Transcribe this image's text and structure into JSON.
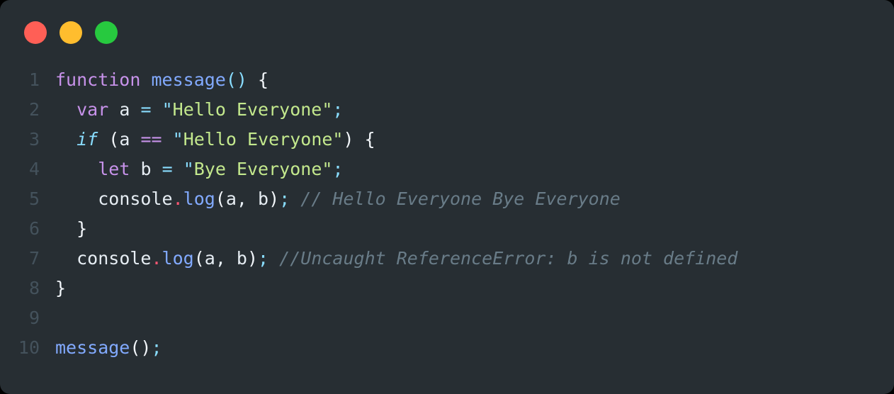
{
  "window": {
    "background_color": "#272e33",
    "outer_color": "#000000",
    "corner_radius_px": 14
  },
  "titlebar": {
    "buttons": [
      {
        "name": "close",
        "label": "",
        "color": "#ff5f56"
      },
      {
        "name": "minimize",
        "label": "",
        "color": "#ffbd2e"
      },
      {
        "name": "maximize",
        "label": "",
        "color": "#27c93f"
      }
    ]
  },
  "editor": {
    "language": "javascript",
    "line_numbers": [
      "1",
      "2",
      "3",
      "4",
      "5",
      "6",
      "7",
      "8",
      "9",
      "10"
    ],
    "lines": [
      {
        "number": "1",
        "text": "function message() {",
        "tokens": [
          {
            "t": "function",
            "c": "tok-keyword"
          },
          {
            "t": " ",
            "c": "tok-plain"
          },
          {
            "t": "message",
            "c": "tok-function"
          },
          {
            "t": "()",
            "c": "tok-punct"
          },
          {
            "t": " ",
            "c": "tok-plain"
          },
          {
            "t": "{",
            "c": "tok-brace"
          }
        ]
      },
      {
        "number": "2",
        "text": "  var a = \"Hello Everyone\";",
        "tokens": [
          {
            "t": "  ",
            "c": "tok-plain"
          },
          {
            "t": "var",
            "c": "tok-keyword"
          },
          {
            "t": " ",
            "c": "tok-plain"
          },
          {
            "t": "a",
            "c": "tok-plain"
          },
          {
            "t": " ",
            "c": "tok-plain"
          },
          {
            "t": "=",
            "c": "tok-assign"
          },
          {
            "t": " ",
            "c": "tok-plain"
          },
          {
            "t": "\"",
            "c": "tok-quote"
          },
          {
            "t": "Hello Everyone",
            "c": "tok-string"
          },
          {
            "t": "\"",
            "c": "tok-string"
          },
          {
            "t": ";",
            "c": "tok-punct"
          }
        ]
      },
      {
        "number": "3",
        "text": "  if (a == \"Hello Everyone\") {",
        "tokens": [
          {
            "t": "  ",
            "c": "tok-plain"
          },
          {
            "t": "if",
            "c": "tok-control"
          },
          {
            "t": " ",
            "c": "tok-plain"
          },
          {
            "t": "(",
            "c": "tok-brace"
          },
          {
            "t": "a",
            "c": "tok-plain"
          },
          {
            "t": " ",
            "c": "tok-plain"
          },
          {
            "t": "==",
            "c": "tok-operator"
          },
          {
            "t": " ",
            "c": "tok-plain"
          },
          {
            "t": "\"",
            "c": "tok-quote"
          },
          {
            "t": "Hello Everyone",
            "c": "tok-string"
          },
          {
            "t": "\"",
            "c": "tok-string"
          },
          {
            "t": ")",
            "c": "tok-brace"
          },
          {
            "t": " ",
            "c": "tok-plain"
          },
          {
            "t": "{",
            "c": "tok-brace"
          }
        ]
      },
      {
        "number": "4",
        "text": "    let b = \"Bye Everyone\";",
        "tokens": [
          {
            "t": "    ",
            "c": "tok-plain"
          },
          {
            "t": "let",
            "c": "tok-keyword"
          },
          {
            "t": " ",
            "c": "tok-plain"
          },
          {
            "t": "b",
            "c": "tok-plain"
          },
          {
            "t": " ",
            "c": "tok-plain"
          },
          {
            "t": "=",
            "c": "tok-assign"
          },
          {
            "t": " ",
            "c": "tok-plain"
          },
          {
            "t": "\"",
            "c": "tok-quote"
          },
          {
            "t": "Bye Everyone",
            "c": "tok-string"
          },
          {
            "t": "\"",
            "c": "tok-string"
          },
          {
            "t": ";",
            "c": "tok-punct"
          }
        ]
      },
      {
        "number": "5",
        "text": "    console.log(a, b); // Hello Everyone Bye Everyone",
        "tokens": [
          {
            "t": "    ",
            "c": "tok-plain"
          },
          {
            "t": "console",
            "c": "tok-plain"
          },
          {
            "t": ".",
            "c": "tok-dot"
          },
          {
            "t": "log",
            "c": "tok-function"
          },
          {
            "t": "(",
            "c": "tok-brace"
          },
          {
            "t": "a",
            "c": "tok-plain"
          },
          {
            "t": ", ",
            "c": "tok-plain"
          },
          {
            "t": "b",
            "c": "tok-plain"
          },
          {
            "t": ")",
            "c": "tok-brace"
          },
          {
            "t": ";",
            "c": "tok-punct"
          },
          {
            "t": " ",
            "c": "tok-plain"
          },
          {
            "t": "// Hello Everyone Bye Everyone",
            "c": "tok-comment"
          }
        ]
      },
      {
        "number": "6",
        "text": "  }",
        "tokens": [
          {
            "t": "  ",
            "c": "tok-plain"
          },
          {
            "t": "}",
            "c": "tok-brace"
          }
        ]
      },
      {
        "number": "7",
        "text": "  console.log(a, b); //Uncaught ReferenceError: b is not defined",
        "tokens": [
          {
            "t": "  ",
            "c": "tok-plain"
          },
          {
            "t": "console",
            "c": "tok-plain"
          },
          {
            "t": ".",
            "c": "tok-dot"
          },
          {
            "t": "log",
            "c": "tok-function"
          },
          {
            "t": "(",
            "c": "tok-brace"
          },
          {
            "t": "a",
            "c": "tok-plain"
          },
          {
            "t": ", ",
            "c": "tok-plain"
          },
          {
            "t": "b",
            "c": "tok-plain"
          },
          {
            "t": ")",
            "c": "tok-brace"
          },
          {
            "t": ";",
            "c": "tok-punct"
          },
          {
            "t": " ",
            "c": "tok-plain"
          },
          {
            "t": "//Uncaught ReferenceError: b is not defined",
            "c": "tok-comment"
          }
        ]
      },
      {
        "number": "8",
        "text": "}",
        "tokens": [
          {
            "t": "}",
            "c": "tok-brace"
          }
        ]
      },
      {
        "number": "9",
        "text": "",
        "tokens": []
      },
      {
        "number": "10",
        "text": "message();",
        "tokens": [
          {
            "t": "message",
            "c": "tok-function"
          },
          {
            "t": "()",
            "c": "tok-brace"
          },
          {
            "t": ";",
            "c": "tok-punct"
          }
        ]
      }
    ]
  },
  "theme": {
    "keyword_color": "#c792ea",
    "function_color": "#82aaff",
    "punctuation_color": "#89ddff",
    "string_color": "#c3e88d",
    "comment_color": "#697c88",
    "plain_text_color": "#e6edf3",
    "line_number_color": "#44525c",
    "accent_dot_red": "#ff5f56",
    "accent_dot_yellow": "#ffbd2e",
    "accent_dot_green": "#27c93f"
  }
}
